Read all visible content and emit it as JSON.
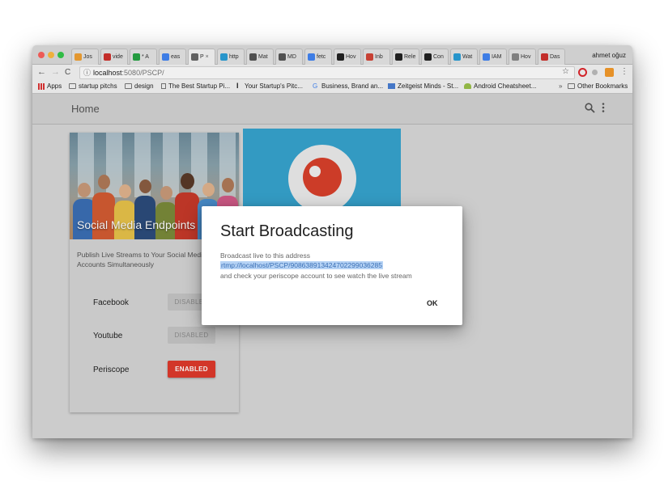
{
  "browser": {
    "tabs": [
      {
        "label": "Jos",
        "favicon_color": "#f2a134"
      },
      {
        "label": "vide",
        "favicon_color": "#d0312d"
      },
      {
        "label": "* A",
        "favicon_color": "#27a545"
      },
      {
        "label": "eas",
        "favicon_color": "#4285f4"
      },
      {
        "label": "P",
        "favicon_color": "#666666",
        "active": true
      },
      {
        "label": "http",
        "favicon_color": "#2a9fd8"
      },
      {
        "label": "Mat",
        "favicon_color": "#555555"
      },
      {
        "label": "MD",
        "favicon_color": "#555555"
      },
      {
        "label": "fetc",
        "favicon_color": "#4285f4"
      },
      {
        "label": "Hov",
        "favicon_color": "#222222"
      },
      {
        "label": "Inb",
        "favicon_color": "#d44638"
      },
      {
        "label": "Rele",
        "favicon_color": "#222222"
      },
      {
        "label": "Con",
        "favicon_color": "#222222"
      },
      {
        "label": "Wat",
        "favicon_color": "#2a9fd8"
      },
      {
        "label": "IAM",
        "favicon_color": "#4285f4"
      },
      {
        "label": "Hov",
        "favicon_color": "#888888"
      },
      {
        "label": "Das",
        "favicon_color": "#d0312d"
      }
    ],
    "profile_name": "ahmet oğuz",
    "url_host": "localhost",
    "url_rest": ":5080/PSCP/",
    "bookmarks": [
      {
        "label": "Apps",
        "icon": "apps-grid-icon"
      },
      {
        "label": "startup pitchs",
        "icon": "folder-icon"
      },
      {
        "label": "design",
        "icon": "folder-icon"
      },
      {
        "label": "The Best Startup Pi...",
        "icon": "page-icon"
      },
      {
        "label": "Your Startup's Pitc...",
        "icon": "page-icon"
      },
      {
        "label": "Business, Brand an...",
        "icon": "google-icon"
      },
      {
        "label": "Zeitgeist Minds - St...",
        "icon": "page-icon"
      },
      {
        "label": "Android Cheatsheet...",
        "icon": "android-icon"
      },
      {
        "label": "Other Bookmarks",
        "icon": "folder-icon"
      }
    ],
    "overflow_label": "»"
  },
  "app": {
    "title": "Home",
    "card": {
      "image_caption": "Social Media Endpoints",
      "description": "Publish Live Streams to Your Social Media Accounts Simultaneously",
      "rows": [
        {
          "label": "Facebook",
          "status": "DISABLED"
        },
        {
          "label": "Youtube",
          "status": "DISABLED"
        },
        {
          "label": "Periscope",
          "status": "ENABLED"
        }
      ]
    },
    "colors": {
      "enabled": "#e03a2c",
      "periscope_bg": "#37a4cf",
      "periscope_red": "#d9402b"
    }
  },
  "dialog": {
    "title": "Start Broadcasting",
    "line1": "Broadcast live to this address",
    "address": "rtmp://localhost/PSCP/908638913424702299036285",
    "line3": "and check your periscope account to see watch the live stream",
    "ok_label": "OK"
  }
}
